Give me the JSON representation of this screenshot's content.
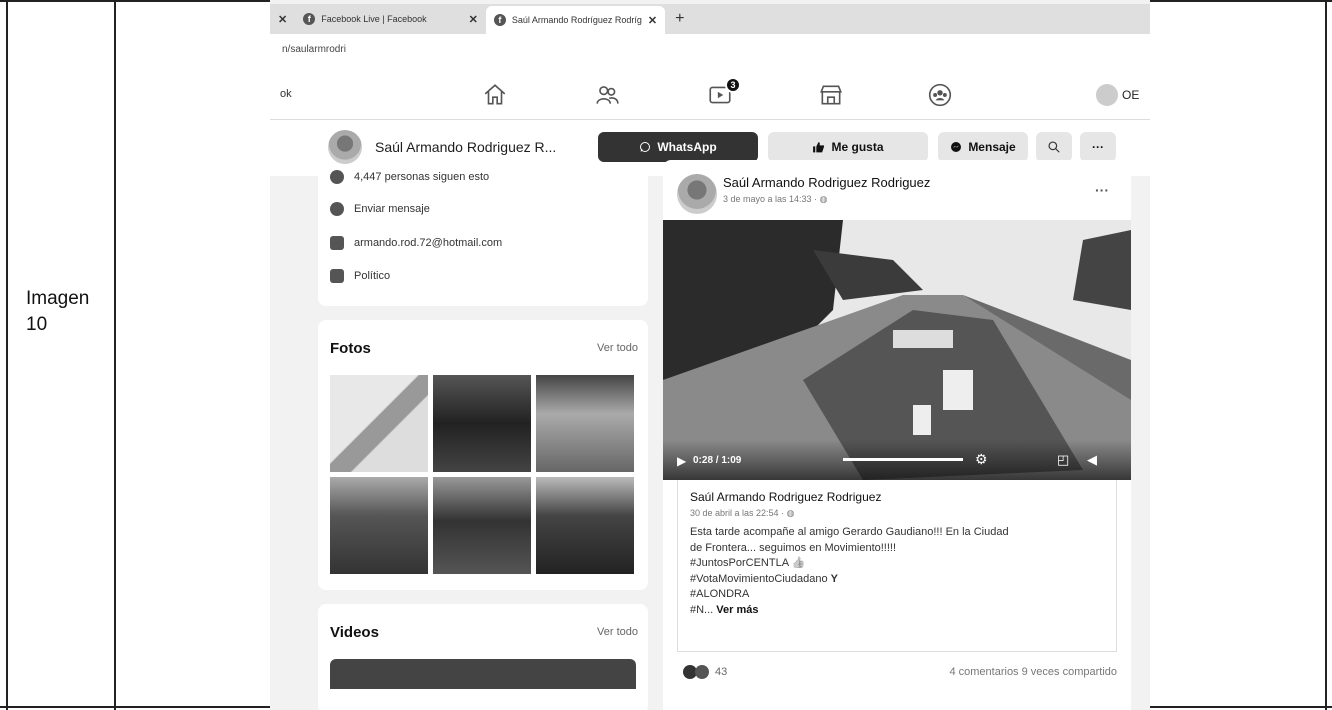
{
  "doc": {
    "row_label": "Imagen 10"
  },
  "browser": {
    "tabs": [
      {
        "label": "Facebook Live | Facebook"
      },
      {
        "label": "Saúl Armando Rodríguez Rodríg"
      }
    ],
    "url": "n/saularmrodri"
  },
  "nav": {
    "left_text": "ok",
    "video_badge": "3",
    "user_label": "OE",
    "icons": [
      "home-icon",
      "friends-icon",
      "watch-icon",
      "marketplace-icon",
      "groups-icon"
    ]
  },
  "page_header": {
    "name": "Saúl Armando Rodriguez R...",
    "whatsapp_label": "WhatsApp",
    "like_label": "Me gusta",
    "message_label": "Mensaje",
    "more_label": "···"
  },
  "intro": {
    "followers": "4,447 personas siguen esto",
    "send_message": "Enviar mensaje",
    "email": "armando.rod.72@hotmail.com",
    "category": "Político"
  },
  "photos": {
    "title": "Fotos",
    "see_all": "Ver todo"
  },
  "videos": {
    "title": "Videos",
    "see_all": "Ver todo"
  },
  "post": {
    "author": "Saúl Armando Rodriguez Rodriguez",
    "date": "3 de mayo a las 14:33 · ",
    "video_time": "0:28 / 1:09",
    "shared_author": "Saúl Armando Rodriguez Rodriguez",
    "shared_date": "30 de abril a las 22:54 · ",
    "text_lines": [
      "Esta tarde acompañe al amigo Gerardo Gaudiano!!! En la Ciudad",
      "de Frontera... seguimos en Movimiento!!!!!",
      "#JuntosPorCENTLA",
      "#VotaMovimientoCiudadano",
      "#ALONDRA",
      "#N..."
    ],
    "see_more": "Ver más",
    "reactions_count": "43",
    "comments_shares": "4 comentarios 9 veces compartido"
  }
}
